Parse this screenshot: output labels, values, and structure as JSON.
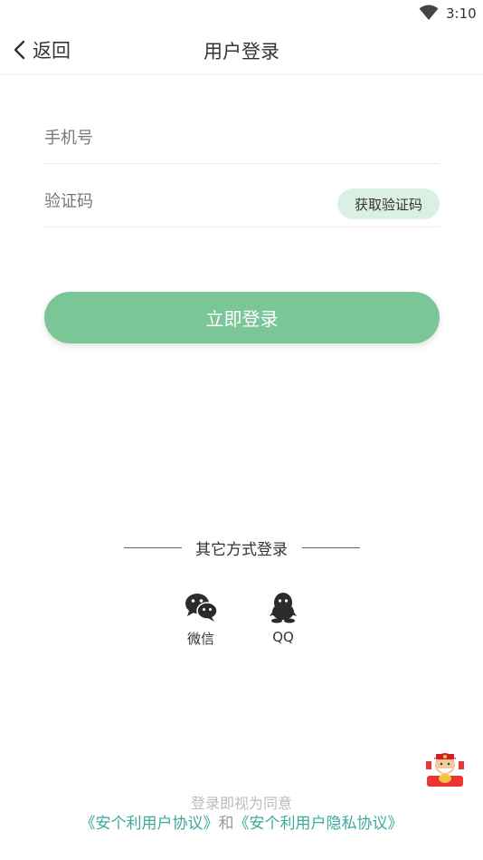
{
  "status_bar": {
    "time": "3:10"
  },
  "nav": {
    "back_label": "返回",
    "title": "用户登录"
  },
  "form": {
    "phone_placeholder": "手机号",
    "code_placeholder": "验证码",
    "get_code_label": "获取验证码",
    "submit_label": "立即登录"
  },
  "other_login": {
    "title": "其它方式登录",
    "options": [
      {
        "label": "微信",
        "icon": "wechat-icon"
      },
      {
        "label": "QQ",
        "icon": "qq-icon"
      }
    ]
  },
  "agreement": {
    "intro": "登录即视为同意",
    "user_agreement": "《安个利用户协议》",
    "conjunction": "和",
    "privacy_agreement": "《安个利用户隐私协议》"
  },
  "colors": {
    "accent": "#7bc697",
    "code_button_bg": "#dbf0e4",
    "link": "#3aa9a0"
  }
}
